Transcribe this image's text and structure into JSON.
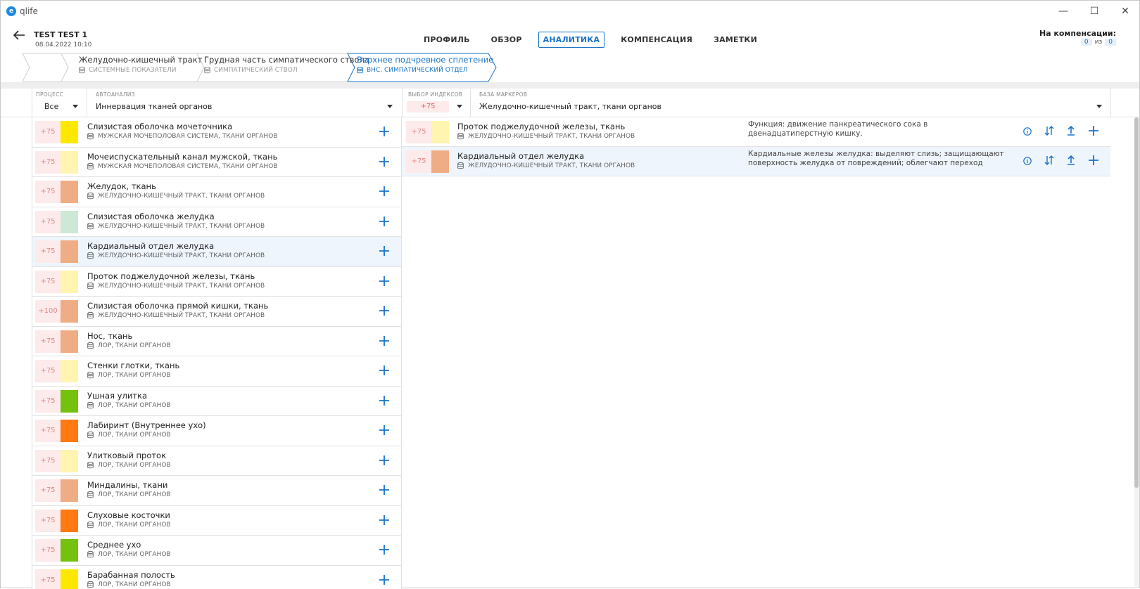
{
  "app": {
    "name": "qlife"
  },
  "window_controls": {
    "minimize": "—",
    "maximize": "☐",
    "close": "✕"
  },
  "patient": {
    "name": "TEST TEST 1",
    "date": "08.04.2022 10:10"
  },
  "nav": {
    "tabs": [
      {
        "label": "ПРОФИЛЬ"
      },
      {
        "label": "ОБЗОР"
      },
      {
        "label": "АНАЛИТИКА"
      },
      {
        "label": "КОМПЕНСАЦИЯ"
      },
      {
        "label": "ЗАМЕТКИ"
      }
    ],
    "active": 2
  },
  "compensation": {
    "label": "На компенсации:",
    "count": "0",
    "of": "из",
    "total": "0"
  },
  "breadcrumb": [
    {
      "title": "Желудочно-кишечный тракт",
      "sub": "СИСТЕМНЫЕ ПОКАЗАТЕЛИ"
    },
    {
      "title": "Грудная часть симпатического ствола",
      "sub": "СИМПАТИЧЕСКИЙ СТВОЛ"
    },
    {
      "title": "Верхнее подчревное сплетение",
      "sub": "ВНС, СИМПАТИЧЕСКИЙ ОТДЕЛ"
    }
  ],
  "filters": {
    "process_label": "ПРОЦЕСС",
    "process_value": "Все",
    "autoanalysis_label": "АВТОАНАЛИЗ",
    "autoanalysis_value": "Иннервация тканей органов",
    "index_label": "ВЫБОР ИНДЕКСОВ",
    "index_value": "+75",
    "markers_label": "БАЗА МАРКЕРОВ",
    "markers_value": "Желудочно-кишечный тракт, ткани органов"
  },
  "left_items": [
    {
      "score": "+75",
      "color": "#ffe800",
      "title": "Слизистая оболочка мочеточника",
      "sub": "МУЖСКАЯ МОЧЕПОЛОВАЯ СИСТЕМА, ТКАНИ ОРГАНОВ"
    },
    {
      "score": "+75",
      "color": "#fff4b0",
      "title": "Мочеиспускательный канал мужской, ткань",
      "sub": "МУЖСКАЯ МОЧЕПОЛОВАЯ СИСТЕМА, ТКАНИ ОРГАНОВ"
    },
    {
      "score": "+75",
      "color": "#efad85",
      "title": "Желудок, ткань",
      "sub": "ЖЕЛУДОЧНО-КИШЕЧНЫЙ ТРАКТ, ТКАНИ ОРГАНОВ"
    },
    {
      "score": "+75",
      "color": "#cde8d5",
      "title": "Слизистая оболочка желудка",
      "sub": "ЖЕЛУДОЧНО-КИШЕЧНЫЙ ТРАКТ, ТКАНИ ОРГАНОВ"
    },
    {
      "score": "+75",
      "color": "#efad85",
      "title": "Кардиальный отдел желудка",
      "sub": "ЖЕЛУДОЧНО-КИШЕЧНЫЙ ТРАКТ, ТКАНИ ОРГАНОВ",
      "selected": true
    },
    {
      "score": "+75",
      "color": "#fff4b0",
      "title": "Проток поджелудочной железы, ткань",
      "sub": "ЖЕЛУДОЧНО-КИШЕЧНЫЙ ТРАКТ, ТКАНИ ОРГАНОВ"
    },
    {
      "score": "+100",
      "color": "#efad85",
      "title": "Слизистая оболочка прямой кишки, ткань",
      "sub": "ЖЕЛУДОЧНО-КИШЕЧНЫЙ ТРАКТ, ТКАНИ ОРГАНОВ"
    },
    {
      "score": "+75",
      "color": "#efad85",
      "title": "Нос, ткань",
      "sub": "ЛОР, ТКАНИ ОРГАНОВ"
    },
    {
      "score": "+75",
      "color": "#fff4b0",
      "title": "Стенки глотки, ткань",
      "sub": "ЛОР, ТКАНИ ОРГАНОВ"
    },
    {
      "score": "+75",
      "color": "#74c20e",
      "title": "Ушная улитка",
      "sub": "ЛОР, ТКАНИ ОРГАНОВ"
    },
    {
      "score": "+75",
      "color": "#ff7a12",
      "title": "Лабиринт (Внутреннее ухо)",
      "sub": "ЛОР, ТКАНИ ОРГАНОВ"
    },
    {
      "score": "+75",
      "color": "#fff4b0",
      "title": "Улитковый проток",
      "sub": "ЛОР, ТКАНИ ОРГАНОВ"
    },
    {
      "score": "+75",
      "color": "#efad85",
      "title": "Миндалины, ткани",
      "sub": "ЛОР, ТКАНИ ОРГАНОВ"
    },
    {
      "score": "+75",
      "color": "#ff7a12",
      "title": "Слуховые косточки",
      "sub": "ЛОР, ТКАНИ ОРГАНОВ"
    },
    {
      "score": "+75",
      "color": "#74c20e",
      "title": "Среднее ухо",
      "sub": "ЛОР, ТКАНИ ОРГАНОВ"
    },
    {
      "score": "+75",
      "color": "#ffe800",
      "title": "Барабанная полость",
      "sub": "ЛОР, ТКАНИ ОРГАНОВ"
    }
  ],
  "right_items": [
    {
      "score": "+75",
      "color": "#fff4b0",
      "title": "Проток поджелудочной железы, ткань",
      "sub": "ЖЕЛУДОЧНО-КИШЕЧНЫЙ ТРАКТ, ТКАНИ ОРГАНОВ",
      "desc": "Функция: движение панкреатического сока в двенадцатиперстную кишку."
    },
    {
      "score": "+75",
      "color": "#efad85",
      "title": "Кардиальный отдел желудка",
      "sub": "ЖЕЛУДОЧНО-КИШЕЧНЫЙ ТРАКТ, ТКАНИ ОРГАНОВ",
      "desc": "Кардиальные железы желудка: выделяют слизь; защищающают поверхность желудка от повреждений; облегчают переход пищево...",
      "selected": true
    }
  ],
  "icons": {
    "add": "plus-icon",
    "info": "info-icon",
    "sort": "sort-icon",
    "upload": "upload-icon",
    "database": "database-icon"
  }
}
